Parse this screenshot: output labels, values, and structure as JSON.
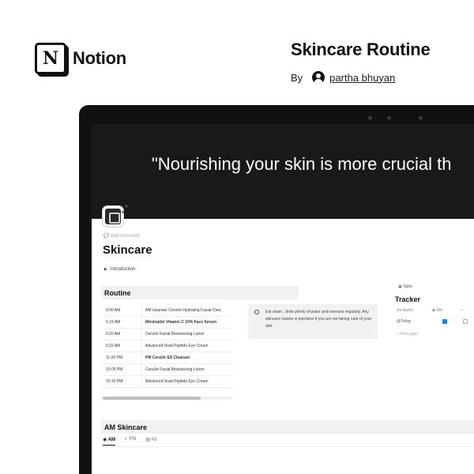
{
  "brand": {
    "logo_letter": "N",
    "name": "Notion"
  },
  "page": {
    "title": "Skincare Routine",
    "by_label": "By",
    "author": "partha bhuyan"
  },
  "screen": {
    "quote": "\"Nourishing your skin is more crucial th",
    "add_comment": "Add comment",
    "doc_title": "Skincare",
    "toggle_arrow": "▶",
    "toggle_label": "Introduction",
    "routine": {
      "heading": "Routine",
      "rows": [
        {
          "time": "6:00 AM",
          "product": "AM cleanser CeraVe Hydrating Facial Clea",
          "bold": false
        },
        {
          "time": "6:15 AM",
          "product": "Minimalist Vitamin C 10% Face Serum",
          "bold": true
        },
        {
          "time": "6:20 AM",
          "product": "CeraVe Facial Moisturizing Lotion",
          "bold": false
        },
        {
          "time": "6:22 AM",
          "product": "Advanced Snail Peptide Eye Cream",
          "bold": false
        },
        {
          "time": "11:00 PM",
          "product": "PM CeraVe SA Cleanser",
          "bold": true
        },
        {
          "time": "10:05 PM",
          "product": "CeraVe Facial Moisturizing Lotion",
          "bold": false
        },
        {
          "time": "10:10 PM",
          "product": "Advanced Snail Peptide Eye Cream",
          "bold": false
        }
      ]
    },
    "callout": "Eat clean , drink plenty of water and exercise regularly. Any skincare routine is pointless if you are not taking care of your diet.",
    "tracker": {
      "table_label": "Table",
      "title": "Tracker",
      "col_name": "Aa Name",
      "col_am": "AM",
      "row_name": "@Today",
      "new_page": "+ New page"
    },
    "am_skincare": {
      "heading": "AM Skincare",
      "tabs": [
        "AM",
        "PM",
        "All"
      ]
    }
  }
}
